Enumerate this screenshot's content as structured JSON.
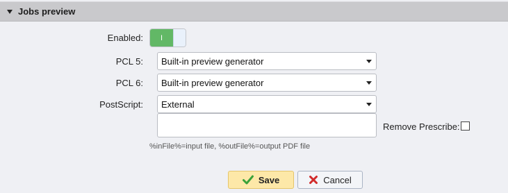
{
  "panel": {
    "title": "Jobs preview"
  },
  "enabled": {
    "label": "Enabled:",
    "toggle_text": "I",
    "value": true
  },
  "pcl5": {
    "label": "PCL 5:",
    "value": "Built-in preview generator"
  },
  "pcl6": {
    "label": "PCL 6:",
    "value": "Built-in preview generator"
  },
  "postscript": {
    "label": "PostScript:",
    "value": "External",
    "command_value": ""
  },
  "remove_prescribe": {
    "label": "Remove Prescribe:",
    "checked": false
  },
  "hint": "%inFile%=input file, %outFile%=output PDF file",
  "buttons": {
    "save": "Save",
    "cancel": "Cancel"
  },
  "icons": {
    "caret": "caret-down-icon",
    "save": "checkmark-icon",
    "cancel": "x-icon"
  },
  "colors": {
    "toggle_on": "#62b866",
    "save_bg": "#fde8a8",
    "check_green": "#3aa23a",
    "cancel_red": "#d12b2b"
  }
}
